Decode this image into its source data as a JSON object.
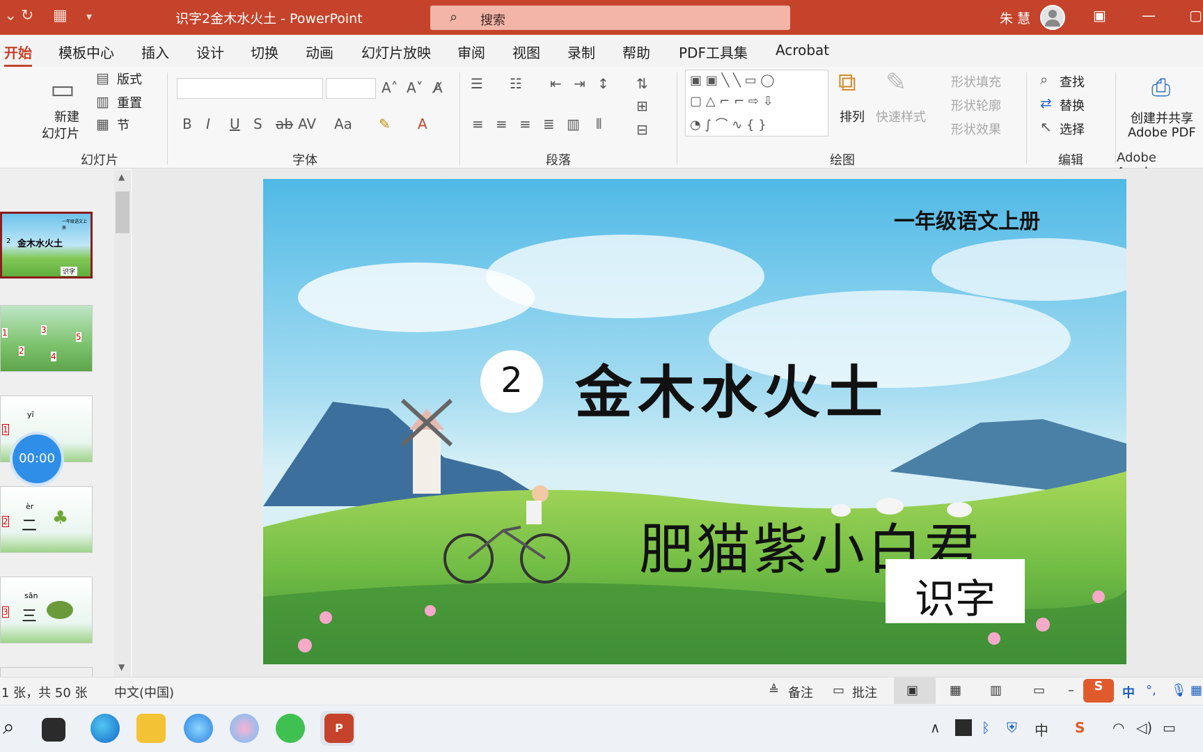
{
  "window": {
    "title": "识字2金木水火土 - PowerPoint",
    "search_placeholder": "搜索",
    "user_name": "朱 慧"
  },
  "ribbon_tabs": [
    "开始",
    "模板中心",
    "插入",
    "设计",
    "切换",
    "动画",
    "幻灯片放映",
    "审阅",
    "视图",
    "录制",
    "帮助",
    "PDF工具集",
    "Acrobat"
  ],
  "ribbon": {
    "slides_group": {
      "label": "幻灯片",
      "new_slide": "新建",
      "new_slide_2": "幻灯片",
      "layout": "版式",
      "reset": "重置",
      "section": "节"
    },
    "font_group": {
      "label": "字体"
    },
    "paragraph_group": {
      "label": "段落"
    },
    "drawing_group": {
      "label": "绘图",
      "arrange": "排列",
      "quick_styles": "快速样式",
      "shape_fill": "形状填充",
      "shape_outline": "形状轮廓",
      "shape_effects": "形状效果"
    },
    "editing_group": {
      "label": "编辑",
      "find": "查找",
      "replace": "替换",
      "select": "选择"
    },
    "acrobat_group": {
      "label": "Adobe Acroba",
      "create_share_1": "创建并共享",
      "create_share_2": "Adobe PDF"
    }
  },
  "slide": {
    "top_right_title": "一年级语文上册",
    "lesson_number": "2",
    "lesson_title": "金木水火土",
    "author": "肥猫紫小白君",
    "tag": "识字"
  },
  "thumbnails": [
    {
      "caption": "一年级语文上册",
      "title": "金木水火土",
      "tag": "识字",
      "number": "2"
    },
    {
      "numbers": [
        "1",
        "3",
        "5",
        "2",
        "4"
      ]
    },
    {
      "pinyin": "yī",
      "number": "1"
    },
    {
      "pinyin": "èr",
      "char": "二",
      "number": "2"
    },
    {
      "pinyin": "sān",
      "char": "三",
      "number": "3"
    }
  ],
  "timer": "00:00",
  "status_bar": {
    "slide_count": "1 张，共 50 张",
    "language": "中文(中国)",
    "notes": "备注",
    "comments": "批注"
  },
  "tray": {
    "ime": "中",
    "ime2": "中"
  },
  "colors": {
    "accent": "#c5432b",
    "selected_thumb": "#8b1d1d",
    "timer": "#2f8ee8"
  }
}
